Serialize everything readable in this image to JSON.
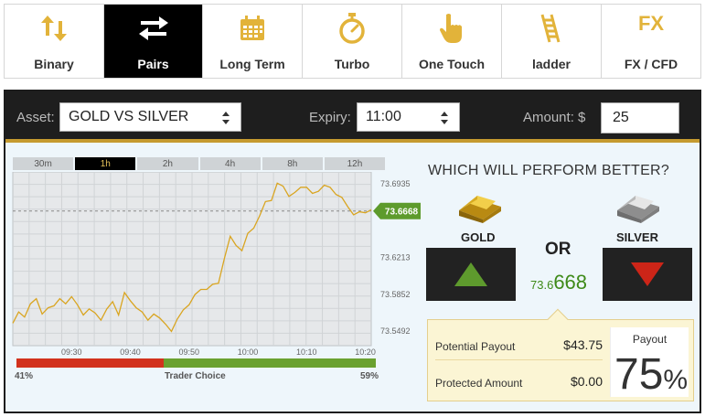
{
  "tabs": [
    {
      "label": "Binary",
      "icon": "arrows-up-down-icon",
      "active": false
    },
    {
      "label": "Pairs",
      "icon": "arrows-left-right-icon",
      "active": true
    },
    {
      "label": "Long Term",
      "icon": "calendar-icon",
      "active": false
    },
    {
      "label": "Turbo",
      "icon": "stopwatch-icon",
      "active": false
    },
    {
      "label": "One Touch",
      "icon": "pointing-hand-icon",
      "active": false
    },
    {
      "label": "ladder",
      "icon": "ladder-icon",
      "active": false
    },
    {
      "label": "FX / CFD",
      "icon": "fx-icon",
      "icon_text": "FX",
      "active": false
    }
  ],
  "controls": {
    "asset_label": "Asset:",
    "asset_value": "GOLD VS SILVER",
    "expiry_label": "Expiry:",
    "expiry_value": "11:00",
    "amount_label": "Amount: $",
    "amount_value": "25"
  },
  "chart": {
    "timeframes": [
      "30m",
      "1h",
      "2h",
      "4h",
      "8h",
      "12h"
    ],
    "active_timeframe": "1h",
    "current_value": "73.6668",
    "choice": {
      "red_percent": 41,
      "green_percent": 59,
      "left_label": "41%",
      "center_label": "Trader Choice",
      "right_label": "59%"
    }
  },
  "chart_data": {
    "type": "line",
    "x_ticks": [
      "09:30",
      "09:40",
      "09:50",
      "10:00",
      "10:10",
      "10:20"
    ],
    "y_ticks": [
      "73.6935",
      "73.6213",
      "73.5852",
      "73.5492"
    ],
    "ylim": [
      73.535,
      73.705
    ],
    "xlim_minutes": [
      0,
      61
    ],
    "current_value": 73.6668,
    "series": [
      {
        "x": [
          0,
          1,
          2,
          3,
          4,
          5,
          6,
          7,
          8,
          9,
          10,
          11,
          12,
          13,
          14,
          15,
          16,
          17,
          18,
          19,
          20,
          21,
          22,
          23,
          24,
          25,
          26,
          27,
          28,
          29,
          30,
          31,
          32,
          33,
          34,
          35,
          36,
          37,
          38,
          39,
          40,
          41,
          42,
          43,
          44,
          45,
          46,
          47,
          48,
          49,
          50,
          51,
          52,
          53,
          54,
          55,
          56,
          57,
          58,
          59,
          60,
          61
        ],
        "y": [
          73.557,
          73.568,
          73.563,
          73.576,
          73.581,
          73.566,
          73.572,
          73.574,
          73.581,
          73.576,
          73.583,
          73.575,
          73.565,
          73.571,
          73.567,
          73.56,
          73.571,
          73.578,
          73.565,
          73.587,
          73.579,
          73.572,
          73.568,
          73.56,
          73.566,
          73.562,
          73.556,
          73.549,
          73.561,
          73.57,
          73.575,
          73.585,
          73.59,
          73.59,
          73.595,
          73.596,
          73.62,
          73.642,
          73.633,
          73.628,
          73.645,
          73.65,
          73.662,
          73.676,
          73.677,
          73.694,
          73.691,
          73.681,
          73.685,
          73.69,
          73.69,
          73.684,
          73.686,
          73.692,
          73.69,
          73.683,
          73.68,
          73.671,
          73.663,
          73.666,
          73.665,
          73.668
        ]
      }
    ]
  },
  "compare": {
    "question": "WHICH WILL PERFORM BETTER?",
    "left_asset": "GOLD",
    "right_asset": "SILVER",
    "or_label": "OR",
    "price_prefix": "73.6",
    "price_suffix": "668",
    "up_color": "#5e9a2d",
    "down_color": "#cc2518"
  },
  "payout": {
    "potential_label": "Potential Payout",
    "potential_value": "$43.75",
    "protected_label": "Protected Amount",
    "protected_value": "$0.00",
    "payout_title": "Payout",
    "payout_value": "75",
    "payout_unit": "%"
  },
  "colors": {
    "accent_gold": "#e2b33a",
    "line_gold": "#d9a521",
    "panel_bg": "#eef6fb",
    "bar_dark": "#1e1e1e"
  }
}
